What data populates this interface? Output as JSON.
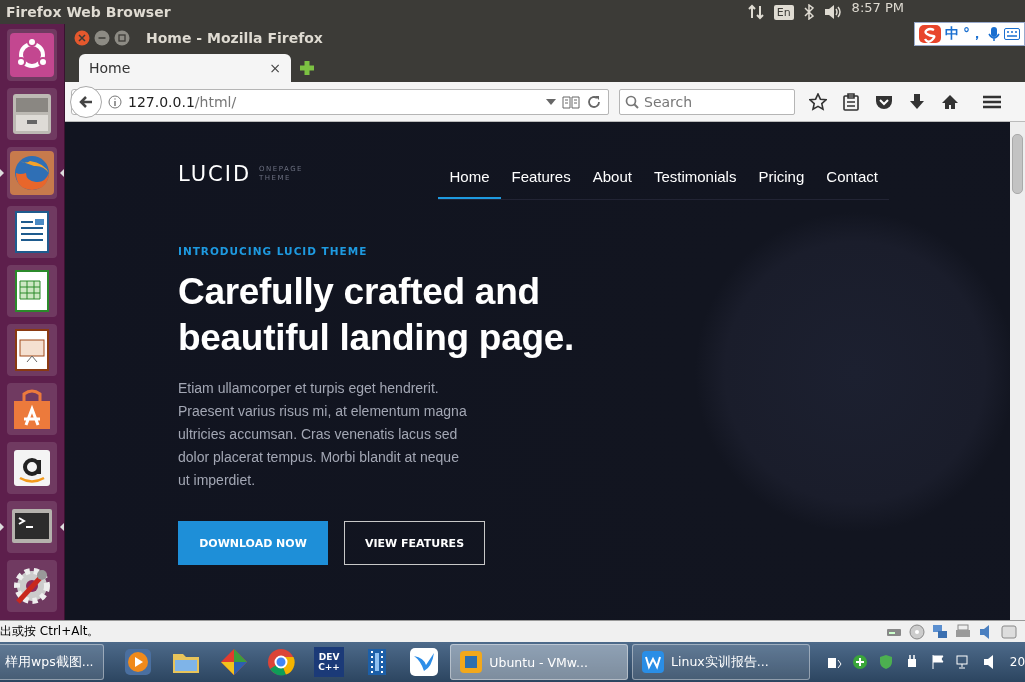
{
  "top_panel": {
    "title": "Firefox Web Browser",
    "keyboard": "En",
    "clock": "8:57 PM",
    "ime_labels": [
      "中",
      "°，"
    ]
  },
  "launcher": {
    "items": [
      {
        "kind": "ubuntu",
        "running": false
      },
      {
        "kind": "files",
        "running": false
      },
      {
        "kind": "firefox",
        "running": true
      },
      {
        "kind": "writer",
        "running": false
      },
      {
        "kind": "calc",
        "running": false
      },
      {
        "kind": "impress",
        "running": false
      },
      {
        "kind": "software",
        "running": false
      },
      {
        "kind": "amazon",
        "running": false
      },
      {
        "kind": "terminal",
        "running": true
      },
      {
        "kind": "settings",
        "running": false
      }
    ]
  },
  "browser": {
    "title": "Home - Mozilla Firefox",
    "tabs": [
      {
        "label": "Home",
        "close": "×",
        "selected": true
      }
    ],
    "url_host": "127.0.0.1",
    "url_path": "/html/",
    "search_placeholder": "Search"
  },
  "page": {
    "logo": "LUCID",
    "logo_sub": [
      "ONEPAGE",
      "THEME"
    ],
    "nav": [
      {
        "label": "Home",
        "selected": true
      },
      {
        "label": "Features",
        "selected": false
      },
      {
        "label": "About",
        "selected": false
      },
      {
        "label": "Testimonials",
        "selected": false
      },
      {
        "label": "Pricing",
        "selected": false
      },
      {
        "label": "Contact",
        "selected": false
      }
    ],
    "eyebrow": "INTRODUCING LUCID THEME",
    "headline": "Carefully crafted and beautiful landing page.",
    "body": "Etiam ullamcorper et turpis eget hendrerit. Praesent varius risus mi, at elementum magna ultricies accumsan. Cras venenatis lacus sed dolor placerat tempus. Morbi blandit at neque ut imperdiet.",
    "buttons": [
      {
        "label": "DOWNLOAD NOW",
        "kind": "primary"
      },
      {
        "label": "VIEW FEATURES",
        "kind": "outline"
      }
    ]
  },
  "vm_hint": "出或按 Ctrl+Alt。",
  "taskbar": {
    "items": [
      {
        "kind": "window",
        "label": "样用wps截图...",
        "selected": false
      },
      {
        "kind": "media"
      },
      {
        "kind": "folder"
      },
      {
        "kind": "cube"
      },
      {
        "kind": "chrome"
      },
      {
        "kind": "devcpp",
        "label": "DEV C++"
      },
      {
        "kind": "film"
      },
      {
        "kind": "bird"
      },
      {
        "kind": "vm-window",
        "label": "Ubuntu - VMw...",
        "selected": true
      },
      {
        "kind": "doc-window",
        "label": "Linux实训报告...",
        "selected": false
      }
    ],
    "clock": "20"
  }
}
